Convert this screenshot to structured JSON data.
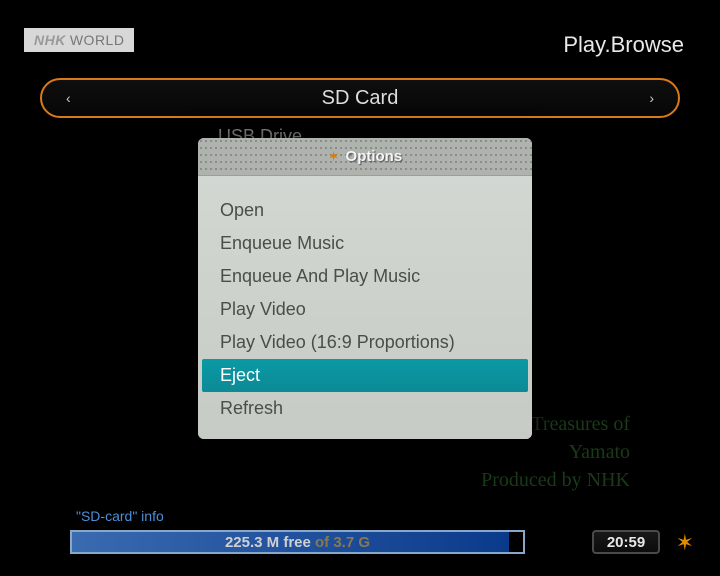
{
  "header": {
    "logo_nhk": "NHK",
    "logo_world": "WORLD",
    "app_title": "Play.Browse"
  },
  "device_selector": {
    "prev": "‹",
    "label": "SD Card",
    "next": "›"
  },
  "background": {
    "usb_label": "USB Drive",
    "title_line1": "National Treasures of",
    "title_line2": "Yamato",
    "producer": "Produced by NHK"
  },
  "options_dialog": {
    "title": "Options",
    "items": [
      {
        "label": "Open",
        "selected": false
      },
      {
        "label": "Enqueue Music",
        "selected": false
      },
      {
        "label": "Enqueue And Play Music",
        "selected": false
      },
      {
        "label": "Play Video",
        "selected": false
      },
      {
        "label": "Play Video (16:9 Proportions)",
        "selected": false
      },
      {
        "label": "Eject",
        "selected": true
      },
      {
        "label": "Refresh",
        "selected": false
      }
    ]
  },
  "footer": {
    "info_label": "\"SD-card\" info",
    "storage_free": "225.3 M free",
    "storage_of": " of 3.7 G",
    "clock": "20:59"
  }
}
